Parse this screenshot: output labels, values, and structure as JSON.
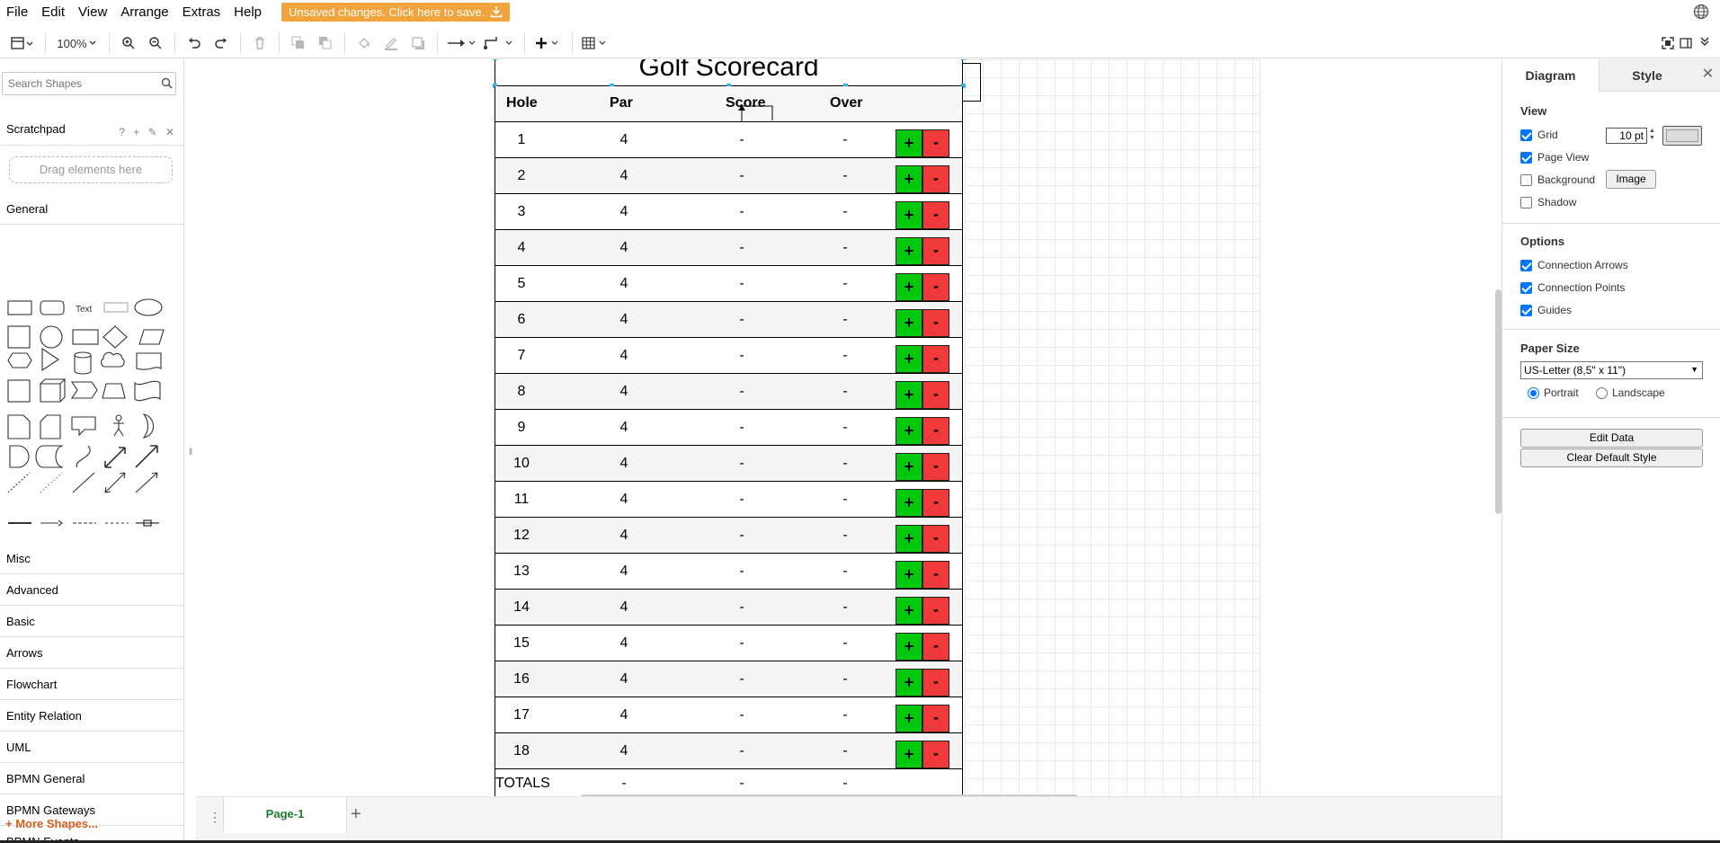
{
  "menubar": {
    "items": [
      "File",
      "Edit",
      "View",
      "Arrange",
      "Extras",
      "Help"
    ],
    "save_banner": "Unsaved changes. Click here to save."
  },
  "toolbar": {
    "zoom": "100%"
  },
  "sidebar": {
    "search_placeholder": "Search Shapes",
    "scratchpad": "Scratchpad",
    "scratch_tools": "? + ✎ ✕",
    "dropzone": "Drag elements here",
    "general": "General",
    "shape_text_label": "Text",
    "sections": [
      "Misc",
      "Advanced",
      "Basic",
      "Arrows",
      "Flowchart",
      "Entity Relation",
      "UML",
      "BPMN General",
      "BPMN Gateways",
      "BPMN Events"
    ],
    "more_shapes": "+ More Shapes..."
  },
  "scorecard": {
    "title": "Golf Scorecard",
    "headers": {
      "hole": "Hole",
      "par": "Par",
      "score": "Score",
      "over": "Over"
    },
    "rows": [
      {
        "hole": "1",
        "par": "4",
        "score": "-",
        "over": "-"
      },
      {
        "hole": "2",
        "par": "4",
        "score": "-",
        "over": "-"
      },
      {
        "hole": "3",
        "par": "4",
        "score": "-",
        "over": "-"
      },
      {
        "hole": "4",
        "par": "4",
        "score": "-",
        "over": "-"
      },
      {
        "hole": "5",
        "par": "4",
        "score": "-",
        "over": "-"
      },
      {
        "hole": "6",
        "par": "4",
        "score": "-",
        "over": "-"
      },
      {
        "hole": "7",
        "par": "4",
        "score": "-",
        "over": "-"
      },
      {
        "hole": "8",
        "par": "4",
        "score": "-",
        "over": "-"
      },
      {
        "hole": "9",
        "par": "4",
        "score": "-",
        "over": "-"
      },
      {
        "hole": "10",
        "par": "4",
        "score": "-",
        "over": "-"
      },
      {
        "hole": "11",
        "par": "4",
        "score": "-",
        "over": "-"
      },
      {
        "hole": "12",
        "par": "4",
        "score": "-",
        "over": "-"
      },
      {
        "hole": "13",
        "par": "4",
        "score": "-",
        "over": "-"
      },
      {
        "hole": "14",
        "par": "4",
        "score": "-",
        "over": "-"
      },
      {
        "hole": "15",
        "par": "4",
        "score": "-",
        "over": "-"
      },
      {
        "hole": "16",
        "par": "4",
        "score": "-",
        "over": "-"
      },
      {
        "hole": "17",
        "par": "4",
        "score": "-",
        "over": "-"
      },
      {
        "hole": "18",
        "par": "4",
        "score": "-",
        "over": "-"
      }
    ],
    "plus_label": "+",
    "minus_label": "-",
    "totals": {
      "label": "TOTALS",
      "par": "-",
      "score": "-",
      "over": "-"
    },
    "colors": {
      "plus": "#00c90d",
      "minus": "#f23a3a"
    }
  },
  "pagebar": {
    "page_tab": "Page-1",
    "add": "+"
  },
  "panel": {
    "tab_diagram": "Diagram",
    "tab_style": "Style",
    "close": "✕",
    "view_header": "View",
    "grid": "Grid",
    "grid_size": "10 pt",
    "page_view": "Page View",
    "background": "Background",
    "image_button": "Image",
    "shadow": "Shadow",
    "options_header": "Options",
    "connection_arrows": "Connection Arrows",
    "connection_points": "Connection Points",
    "guides": "Guides",
    "paper_header": "Paper Size",
    "paper_value": "US-Letter (8,5\" x 11\")",
    "portrait": "Portrait",
    "landscape": "Landscape",
    "edit_data": "Edit Data",
    "clear_style": "Clear Default Style"
  }
}
